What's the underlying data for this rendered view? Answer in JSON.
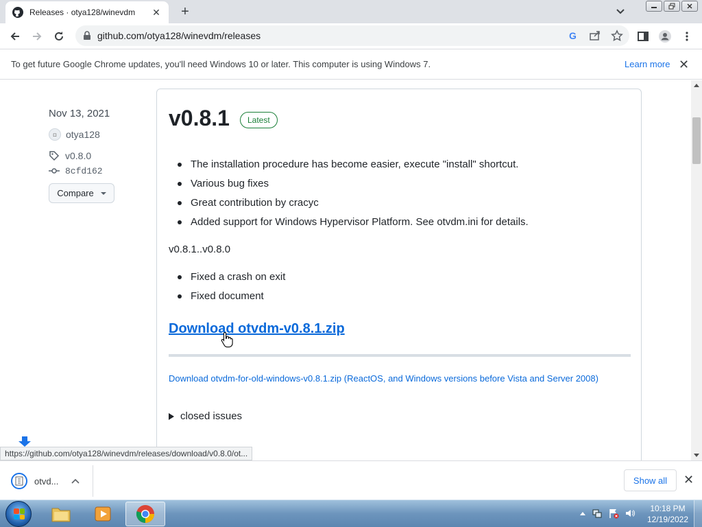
{
  "browser": {
    "tab_title": "Releases · otya128/winevdm",
    "tab_close": "✕",
    "new_tab": "+",
    "url": "github.com/otya128/winevdm/releases"
  },
  "infobar": {
    "message": "To get future Google Chrome updates, you'll need Windows 10 or later. This computer is using Windows 7.",
    "learn_more": "Learn more",
    "close": "✕"
  },
  "sidebar": {
    "date": "Nov 13, 2021",
    "author": "otya128",
    "tag": "v0.8.0",
    "commit": "8cfd162",
    "compare_label": "Compare"
  },
  "release": {
    "title": "v0.8.1",
    "badge": "Latest",
    "notes": [
      "The installation procedure has become easier, execute \"install\" shortcut.",
      "Various bug fixes",
      "Great contribution by cracyc",
      "Added support for Windows Hypervisor Platform. See otvdm.ini for details."
    ],
    "compare_range": "v0.8.1..v0.8.0",
    "changes": [
      "Fixed a crash on exit",
      "Fixed document"
    ],
    "download_main": "Download otvdm-v0.8.1.zip",
    "download_old": "Download otvdm-for-old-windows-v0.8.1.zip (ReactOS, and Windows versions before Vista and Server 2008)",
    "closed_issues": "closed issues"
  },
  "status_url": "https://github.com/otya128/winevdm/releases/download/v0.8.0/ot...",
  "download_shelf": {
    "file_name": "otvd...",
    "show_all": "Show all",
    "close": "✕"
  },
  "taskbar": {
    "time": "10:18 PM",
    "date": "12/19/2022"
  },
  "colors": {
    "link": "#0969da",
    "latest_badge": "#1a7f37",
    "chrome_blue": "#1a73e8"
  }
}
